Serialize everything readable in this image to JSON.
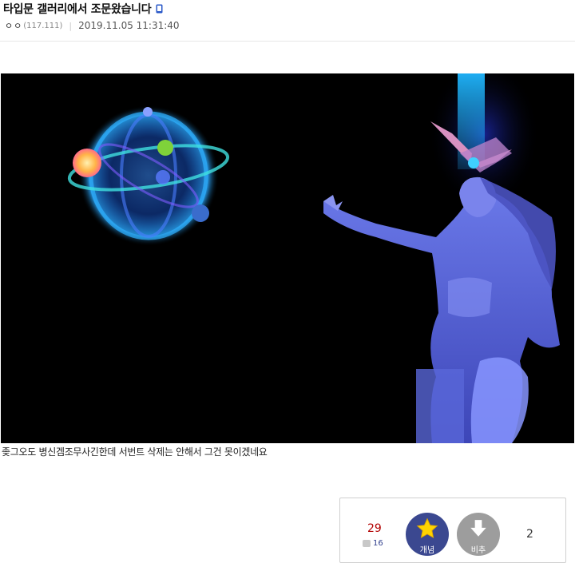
{
  "post": {
    "title": "타입문 갤러리에서 조문왔습니다",
    "author_nick": "ㅇㅇ",
    "author_ip": "(117.111)",
    "separator": "|",
    "date": "2019.11.05 11:31:40"
  },
  "content": {
    "text": "좆그오도 병신겜조무사긴한데 서번트 삭제는 안해서 그건 못이겠네요"
  },
  "recommend": {
    "up_count": "29",
    "fix_count": "16",
    "up_label": "개념",
    "down_label": "비추",
    "down_count": "2"
  },
  "colors": {
    "up_button": "#3b4890",
    "down_button": "#9d9d9d",
    "up_count": "#b20000",
    "star": "#ffd400",
    "image_background": "#000000"
  }
}
